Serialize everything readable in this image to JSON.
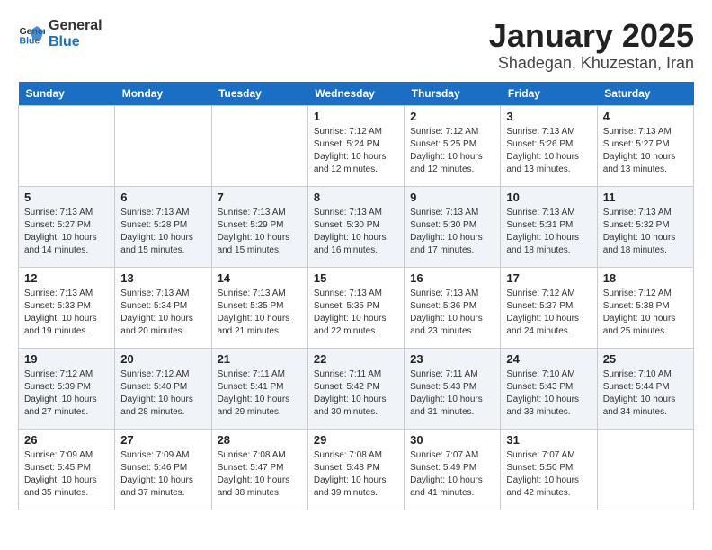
{
  "header": {
    "logo_general": "General",
    "logo_blue": "Blue",
    "month_year": "January 2025",
    "location": "Shadegan, Khuzestan, Iran"
  },
  "weekdays": [
    "Sunday",
    "Monday",
    "Tuesday",
    "Wednesday",
    "Thursday",
    "Friday",
    "Saturday"
  ],
  "weeks": [
    [
      {
        "day": "",
        "info": ""
      },
      {
        "day": "",
        "info": ""
      },
      {
        "day": "",
        "info": ""
      },
      {
        "day": "1",
        "info": "Sunrise: 7:12 AM\nSunset: 5:24 PM\nDaylight: 10 hours\nand 12 minutes."
      },
      {
        "day": "2",
        "info": "Sunrise: 7:12 AM\nSunset: 5:25 PM\nDaylight: 10 hours\nand 12 minutes."
      },
      {
        "day": "3",
        "info": "Sunrise: 7:13 AM\nSunset: 5:26 PM\nDaylight: 10 hours\nand 13 minutes."
      },
      {
        "day": "4",
        "info": "Sunrise: 7:13 AM\nSunset: 5:27 PM\nDaylight: 10 hours\nand 13 minutes."
      }
    ],
    [
      {
        "day": "5",
        "info": "Sunrise: 7:13 AM\nSunset: 5:27 PM\nDaylight: 10 hours\nand 14 minutes."
      },
      {
        "day": "6",
        "info": "Sunrise: 7:13 AM\nSunset: 5:28 PM\nDaylight: 10 hours\nand 15 minutes."
      },
      {
        "day": "7",
        "info": "Sunrise: 7:13 AM\nSunset: 5:29 PM\nDaylight: 10 hours\nand 15 minutes."
      },
      {
        "day": "8",
        "info": "Sunrise: 7:13 AM\nSunset: 5:30 PM\nDaylight: 10 hours\nand 16 minutes."
      },
      {
        "day": "9",
        "info": "Sunrise: 7:13 AM\nSunset: 5:30 PM\nDaylight: 10 hours\nand 17 minutes."
      },
      {
        "day": "10",
        "info": "Sunrise: 7:13 AM\nSunset: 5:31 PM\nDaylight: 10 hours\nand 18 minutes."
      },
      {
        "day": "11",
        "info": "Sunrise: 7:13 AM\nSunset: 5:32 PM\nDaylight: 10 hours\nand 18 minutes."
      }
    ],
    [
      {
        "day": "12",
        "info": "Sunrise: 7:13 AM\nSunset: 5:33 PM\nDaylight: 10 hours\nand 19 minutes."
      },
      {
        "day": "13",
        "info": "Sunrise: 7:13 AM\nSunset: 5:34 PM\nDaylight: 10 hours\nand 20 minutes."
      },
      {
        "day": "14",
        "info": "Sunrise: 7:13 AM\nSunset: 5:35 PM\nDaylight: 10 hours\nand 21 minutes."
      },
      {
        "day": "15",
        "info": "Sunrise: 7:13 AM\nSunset: 5:35 PM\nDaylight: 10 hours\nand 22 minutes."
      },
      {
        "day": "16",
        "info": "Sunrise: 7:13 AM\nSunset: 5:36 PM\nDaylight: 10 hours\nand 23 minutes."
      },
      {
        "day": "17",
        "info": "Sunrise: 7:12 AM\nSunset: 5:37 PM\nDaylight: 10 hours\nand 24 minutes."
      },
      {
        "day": "18",
        "info": "Sunrise: 7:12 AM\nSunset: 5:38 PM\nDaylight: 10 hours\nand 25 minutes."
      }
    ],
    [
      {
        "day": "19",
        "info": "Sunrise: 7:12 AM\nSunset: 5:39 PM\nDaylight: 10 hours\nand 27 minutes."
      },
      {
        "day": "20",
        "info": "Sunrise: 7:12 AM\nSunset: 5:40 PM\nDaylight: 10 hours\nand 28 minutes."
      },
      {
        "day": "21",
        "info": "Sunrise: 7:11 AM\nSunset: 5:41 PM\nDaylight: 10 hours\nand 29 minutes."
      },
      {
        "day": "22",
        "info": "Sunrise: 7:11 AM\nSunset: 5:42 PM\nDaylight: 10 hours\nand 30 minutes."
      },
      {
        "day": "23",
        "info": "Sunrise: 7:11 AM\nSunset: 5:43 PM\nDaylight: 10 hours\nand 31 minutes."
      },
      {
        "day": "24",
        "info": "Sunrise: 7:10 AM\nSunset: 5:43 PM\nDaylight: 10 hours\nand 33 minutes."
      },
      {
        "day": "25",
        "info": "Sunrise: 7:10 AM\nSunset: 5:44 PM\nDaylight: 10 hours\nand 34 minutes."
      }
    ],
    [
      {
        "day": "26",
        "info": "Sunrise: 7:09 AM\nSunset: 5:45 PM\nDaylight: 10 hours\nand 35 minutes."
      },
      {
        "day": "27",
        "info": "Sunrise: 7:09 AM\nSunset: 5:46 PM\nDaylight: 10 hours\nand 37 minutes."
      },
      {
        "day": "28",
        "info": "Sunrise: 7:08 AM\nSunset: 5:47 PM\nDaylight: 10 hours\nand 38 minutes."
      },
      {
        "day": "29",
        "info": "Sunrise: 7:08 AM\nSunset: 5:48 PM\nDaylight: 10 hours\nand 39 minutes."
      },
      {
        "day": "30",
        "info": "Sunrise: 7:07 AM\nSunset: 5:49 PM\nDaylight: 10 hours\nand 41 minutes."
      },
      {
        "day": "31",
        "info": "Sunrise: 7:07 AM\nSunset: 5:50 PM\nDaylight: 10 hours\nand 42 minutes."
      },
      {
        "day": "",
        "info": ""
      }
    ]
  ]
}
